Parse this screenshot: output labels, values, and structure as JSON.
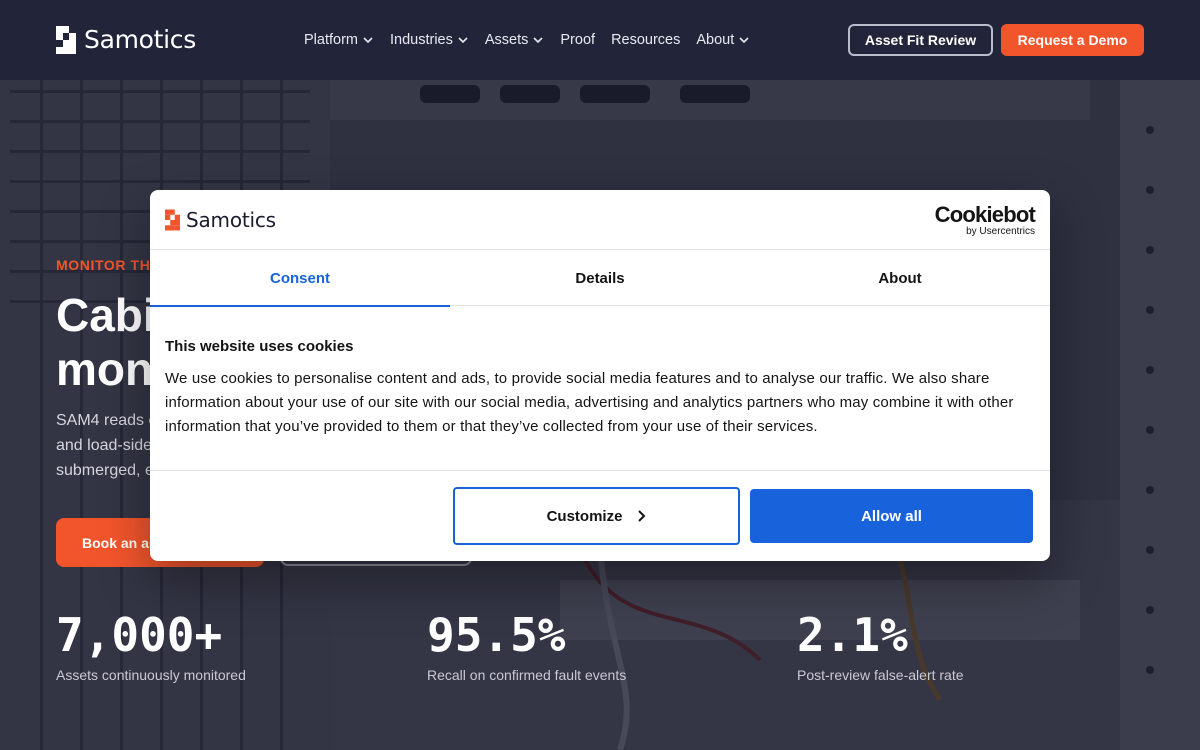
{
  "colors": {
    "navy": "#22243a",
    "brand_orange": "#f2552c",
    "cookie_blue": "#1863dc"
  },
  "nav": {
    "brand": "Samotics",
    "items": [
      {
        "label": "Platform",
        "has_menu": true
      },
      {
        "label": "Industries",
        "has_menu": true
      },
      {
        "label": "Assets",
        "has_menu": true
      },
      {
        "label": "Proof",
        "has_menu": false
      },
      {
        "label": "Resources",
        "has_menu": false
      },
      {
        "label": "About",
        "has_menu": true
      }
    ],
    "secondary_cta": "Asset Fit Review",
    "primary_cta": "Request a Demo"
  },
  "hero": {
    "eyebrow": "MONITOR TH",
    "headline_line1": "Cabi",
    "headline_line2": "mon",
    "lede_line1": "SAM4 reads c",
    "lede_line2": "and load-side",
    "lede_line3": "submerged, e",
    "cta_primary": "Book an as",
    "stats": [
      {
        "value": "7,000+",
        "label": "Assets continuously monitored"
      },
      {
        "value": "95.5%",
        "label": "Recall on confirmed fault events"
      },
      {
        "value": "2.1%",
        "label": "Post-review false-alert rate"
      }
    ]
  },
  "cookie_dialog": {
    "brand": "Samotics",
    "provider_logo": "Cookiebot",
    "provider_sub": "by Usercentrics",
    "tabs": [
      {
        "label": "Consent",
        "active": true
      },
      {
        "label": "Details",
        "active": false
      },
      {
        "label": "About",
        "active": false
      }
    ],
    "title": "This website uses cookies",
    "text": "We use cookies to personalise content and ads, to provide social media features and to analyse our traffic. We also share information about your use of our site with our social media, advertising and analytics partners who may combine it with other information that you’ve provided to them or that they’ve collected from your use of their services.",
    "customize_label": "Customize",
    "allow_all_label": "Allow all"
  }
}
